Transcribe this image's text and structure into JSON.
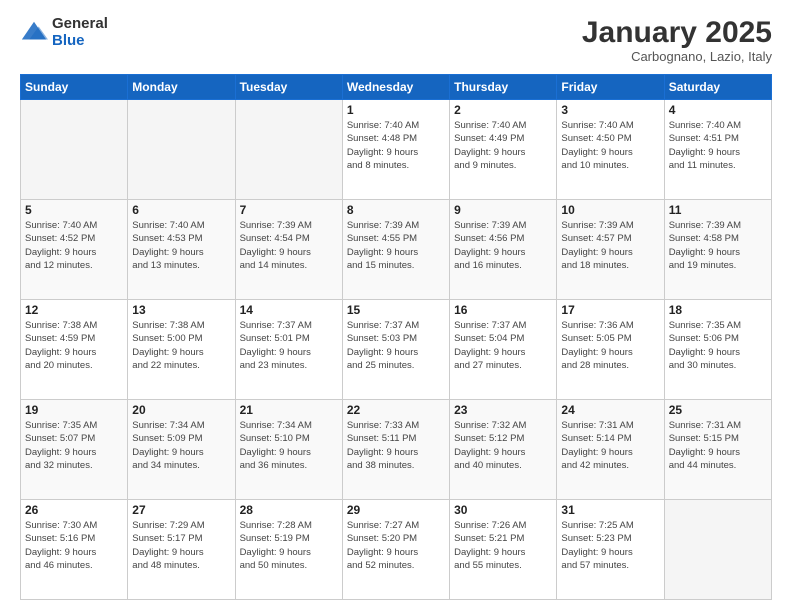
{
  "logo": {
    "general": "General",
    "blue": "Blue"
  },
  "header": {
    "month": "January 2025",
    "location": "Carbognano, Lazio, Italy"
  },
  "weekdays": [
    "Sunday",
    "Monday",
    "Tuesday",
    "Wednesday",
    "Thursday",
    "Friday",
    "Saturday"
  ],
  "weeks": [
    [
      {
        "day": "",
        "info": ""
      },
      {
        "day": "",
        "info": ""
      },
      {
        "day": "",
        "info": ""
      },
      {
        "day": "1",
        "info": "Sunrise: 7:40 AM\nSunset: 4:48 PM\nDaylight: 9 hours\nand 8 minutes."
      },
      {
        "day": "2",
        "info": "Sunrise: 7:40 AM\nSunset: 4:49 PM\nDaylight: 9 hours\nand 9 minutes."
      },
      {
        "day": "3",
        "info": "Sunrise: 7:40 AM\nSunset: 4:50 PM\nDaylight: 9 hours\nand 10 minutes."
      },
      {
        "day": "4",
        "info": "Sunrise: 7:40 AM\nSunset: 4:51 PM\nDaylight: 9 hours\nand 11 minutes."
      }
    ],
    [
      {
        "day": "5",
        "info": "Sunrise: 7:40 AM\nSunset: 4:52 PM\nDaylight: 9 hours\nand 12 minutes."
      },
      {
        "day": "6",
        "info": "Sunrise: 7:40 AM\nSunset: 4:53 PM\nDaylight: 9 hours\nand 13 minutes."
      },
      {
        "day": "7",
        "info": "Sunrise: 7:39 AM\nSunset: 4:54 PM\nDaylight: 9 hours\nand 14 minutes."
      },
      {
        "day": "8",
        "info": "Sunrise: 7:39 AM\nSunset: 4:55 PM\nDaylight: 9 hours\nand 15 minutes."
      },
      {
        "day": "9",
        "info": "Sunrise: 7:39 AM\nSunset: 4:56 PM\nDaylight: 9 hours\nand 16 minutes."
      },
      {
        "day": "10",
        "info": "Sunrise: 7:39 AM\nSunset: 4:57 PM\nDaylight: 9 hours\nand 18 minutes."
      },
      {
        "day": "11",
        "info": "Sunrise: 7:39 AM\nSunset: 4:58 PM\nDaylight: 9 hours\nand 19 minutes."
      }
    ],
    [
      {
        "day": "12",
        "info": "Sunrise: 7:38 AM\nSunset: 4:59 PM\nDaylight: 9 hours\nand 20 minutes."
      },
      {
        "day": "13",
        "info": "Sunrise: 7:38 AM\nSunset: 5:00 PM\nDaylight: 9 hours\nand 22 minutes."
      },
      {
        "day": "14",
        "info": "Sunrise: 7:37 AM\nSunset: 5:01 PM\nDaylight: 9 hours\nand 23 minutes."
      },
      {
        "day": "15",
        "info": "Sunrise: 7:37 AM\nSunset: 5:03 PM\nDaylight: 9 hours\nand 25 minutes."
      },
      {
        "day": "16",
        "info": "Sunrise: 7:37 AM\nSunset: 5:04 PM\nDaylight: 9 hours\nand 27 minutes."
      },
      {
        "day": "17",
        "info": "Sunrise: 7:36 AM\nSunset: 5:05 PM\nDaylight: 9 hours\nand 28 minutes."
      },
      {
        "day": "18",
        "info": "Sunrise: 7:35 AM\nSunset: 5:06 PM\nDaylight: 9 hours\nand 30 minutes."
      }
    ],
    [
      {
        "day": "19",
        "info": "Sunrise: 7:35 AM\nSunset: 5:07 PM\nDaylight: 9 hours\nand 32 minutes."
      },
      {
        "day": "20",
        "info": "Sunrise: 7:34 AM\nSunset: 5:09 PM\nDaylight: 9 hours\nand 34 minutes."
      },
      {
        "day": "21",
        "info": "Sunrise: 7:34 AM\nSunset: 5:10 PM\nDaylight: 9 hours\nand 36 minutes."
      },
      {
        "day": "22",
        "info": "Sunrise: 7:33 AM\nSunset: 5:11 PM\nDaylight: 9 hours\nand 38 minutes."
      },
      {
        "day": "23",
        "info": "Sunrise: 7:32 AM\nSunset: 5:12 PM\nDaylight: 9 hours\nand 40 minutes."
      },
      {
        "day": "24",
        "info": "Sunrise: 7:31 AM\nSunset: 5:14 PM\nDaylight: 9 hours\nand 42 minutes."
      },
      {
        "day": "25",
        "info": "Sunrise: 7:31 AM\nSunset: 5:15 PM\nDaylight: 9 hours\nand 44 minutes."
      }
    ],
    [
      {
        "day": "26",
        "info": "Sunrise: 7:30 AM\nSunset: 5:16 PM\nDaylight: 9 hours\nand 46 minutes."
      },
      {
        "day": "27",
        "info": "Sunrise: 7:29 AM\nSunset: 5:17 PM\nDaylight: 9 hours\nand 48 minutes."
      },
      {
        "day": "28",
        "info": "Sunrise: 7:28 AM\nSunset: 5:19 PM\nDaylight: 9 hours\nand 50 minutes."
      },
      {
        "day": "29",
        "info": "Sunrise: 7:27 AM\nSunset: 5:20 PM\nDaylight: 9 hours\nand 52 minutes."
      },
      {
        "day": "30",
        "info": "Sunrise: 7:26 AM\nSunset: 5:21 PM\nDaylight: 9 hours\nand 55 minutes."
      },
      {
        "day": "31",
        "info": "Sunrise: 7:25 AM\nSunset: 5:23 PM\nDaylight: 9 hours\nand 57 minutes."
      },
      {
        "day": "",
        "info": ""
      }
    ]
  ]
}
